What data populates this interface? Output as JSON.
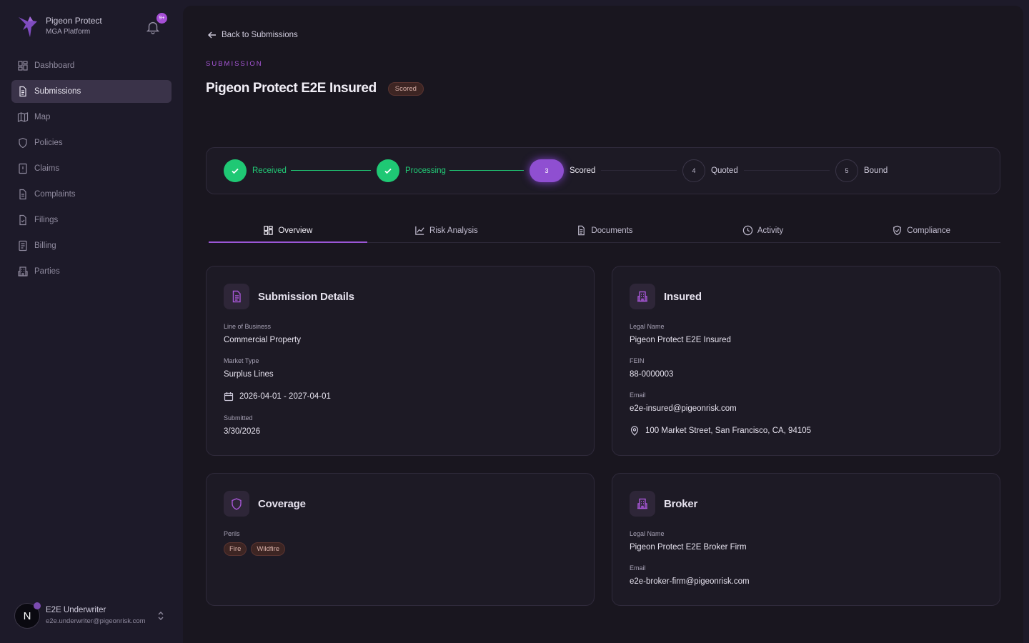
{
  "sidebar": {
    "brand_name": "Pigeon Protect",
    "brand_sub": "MGA Platform",
    "notification_badge": "9+",
    "items": [
      {
        "label": "Dashboard",
        "icon": "dashboard-icon"
      },
      {
        "label": "Submissions",
        "icon": "document-icon",
        "active": true
      },
      {
        "label": "Map",
        "icon": "map-icon"
      },
      {
        "label": "Policies",
        "icon": "shield-icon"
      },
      {
        "label": "Claims",
        "icon": "claim-icon"
      },
      {
        "label": "Complaints",
        "icon": "complaint-icon"
      },
      {
        "label": "Filings",
        "icon": "filing-icon"
      },
      {
        "label": "Billing",
        "icon": "billing-icon"
      },
      {
        "label": "Parties",
        "icon": "building-icon"
      }
    ],
    "user": {
      "initial": "N",
      "name": "E2E Underwriter",
      "email": "e2e.underwriter@pigeonrisk.com"
    }
  },
  "header": {
    "back_label": "Back to Submissions",
    "eyebrow": "SUBMISSION",
    "title": "Pigeon Protect E2E Insured",
    "status_badge": "Scored"
  },
  "stepper": {
    "steps": [
      {
        "label": "Received",
        "state": "done",
        "number": ""
      },
      {
        "label": "Processing",
        "state": "done",
        "number": ""
      },
      {
        "label": "Scored",
        "state": "current",
        "number": "3"
      },
      {
        "label": "Quoted",
        "state": "todo",
        "number": "4"
      },
      {
        "label": "Bound",
        "state": "todo",
        "number": "5"
      }
    ]
  },
  "tabs": [
    {
      "label": "Overview",
      "icon": "grid-icon",
      "active": true
    },
    {
      "label": "Risk Analysis",
      "icon": "chart-icon"
    },
    {
      "label": "Documents",
      "icon": "document-icon"
    },
    {
      "label": "Activity",
      "icon": "clock-icon"
    },
    {
      "label": "Compliance",
      "icon": "shield-check-icon"
    }
  ],
  "submission_details": {
    "title": "Submission Details",
    "lob_label": "Line of Business",
    "lob_value": "Commercial Property",
    "market_label": "Market Type",
    "market_value": "Surplus Lines",
    "period": "2026-04-01 - 2027-04-01",
    "submitted_label": "Submitted",
    "submitted_value": "3/30/2026"
  },
  "insured": {
    "title": "Insured",
    "legal_label": "Legal Name",
    "legal_value": "Pigeon Protect E2E Insured",
    "fein_label": "FEIN",
    "fein_value": "88-0000003",
    "email_label": "Email",
    "email_value": "e2e-insured@pigeonrisk.com",
    "address": "100 Market Street, San Francisco, CA, 94105"
  },
  "coverage": {
    "title": "Coverage",
    "perils_label": "Perils",
    "perils": [
      "Fire",
      "Wildfire"
    ]
  },
  "broker": {
    "title": "Broker",
    "legal_label": "Legal Name",
    "legal_value": "Pigeon Protect E2E Broker Firm",
    "email_label": "Email",
    "email_value": "e2e-broker-firm@pigeonrisk.com"
  },
  "colors": {
    "accent": "#9b56d6",
    "success": "#1fc874",
    "badge_bg": "#3d2523"
  }
}
